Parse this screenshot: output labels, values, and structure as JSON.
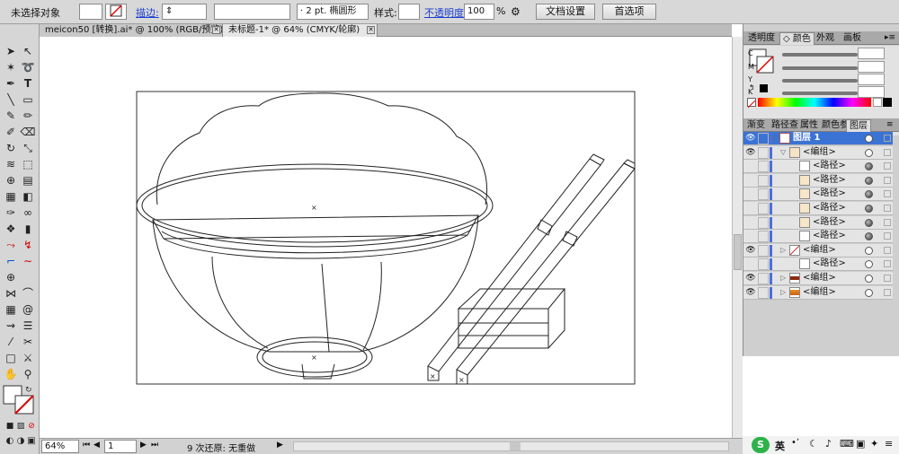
{
  "control_bar": {
    "selection": "未选择对象",
    "stroke_label": "描边:",
    "stroke_size": "2 pt.",
    "brush": "椭圆形",
    "style_label": "样式:",
    "opacity_label": "不透明度:",
    "opacity_value": "100",
    "opacity_unit": "%",
    "doc_setup": "文档设置",
    "prefs": "首选项"
  },
  "tabs": [
    {
      "label": "meicon50 [转换].ai* @ 100% (RGB/预览)"
    },
    {
      "label": "未标题-1* @ 64% (CMYK/轮廓)"
    }
  ],
  "status": {
    "zoom": "64%",
    "page": "1",
    "history": "9 次还原: 无重做"
  },
  "color_panel": {
    "tabs": [
      "透明度",
      "颜色",
      "外观",
      "画板"
    ],
    "channels": [
      "C",
      "M",
      "Y",
      "K"
    ]
  },
  "layers_panel": {
    "tabs": [
      "渐变",
      "路径查",
      "属性",
      "颜色参",
      "图层"
    ],
    "rows": [
      {
        "label": "图层 1",
        "indent": 0,
        "visible": true,
        "twisty": "open",
        "thumb": "layer",
        "target": "hollow",
        "selected": true
      },
      {
        "label": "<编组>",
        "indent": 1,
        "visible": true,
        "twisty": "open",
        "thumb": "group",
        "target": "hollow",
        "selected": false
      },
      {
        "label": "<路径>",
        "indent": 2,
        "visible": false,
        "twisty": "",
        "thumb": "blank",
        "target": "filled",
        "selected": false
      },
      {
        "label": "<路径>",
        "indent": 2,
        "visible": false,
        "twisty": "",
        "thumb": "beige",
        "target": "filled",
        "selected": false
      },
      {
        "label": "<路径>",
        "indent": 2,
        "visible": false,
        "twisty": "",
        "thumb": "beige",
        "target": "filled",
        "selected": false
      },
      {
        "label": "<路径>",
        "indent": 2,
        "visible": false,
        "twisty": "",
        "thumb": "beige",
        "target": "filled",
        "selected": false
      },
      {
        "label": "<路径>",
        "indent": 2,
        "visible": false,
        "twisty": "",
        "thumb": "beige",
        "target": "filled",
        "selected": false
      },
      {
        "label": "<路径>",
        "indent": 2,
        "visible": false,
        "twisty": "",
        "thumb": "blank",
        "target": "filled",
        "selected": false
      },
      {
        "label": "<编组>",
        "indent": 1,
        "visible": true,
        "twisty": "closed",
        "thumb": "slash",
        "target": "hollow",
        "selected": false
      },
      {
        "label": "<路径>",
        "indent": 2,
        "visible": false,
        "twisty": "",
        "thumb": "blank",
        "target": "hollow",
        "selected": false
      },
      {
        "label": "<编组>",
        "indent": 1,
        "visible": true,
        "twisty": "closed",
        "thumb": "brown",
        "target": "hollow",
        "selected": false
      },
      {
        "label": "<编组>",
        "indent": 1,
        "visible": true,
        "twisty": "closed",
        "thumb": "orange",
        "target": "hollow",
        "selected": false
      }
    ]
  },
  "taskbar": {
    "ime": "英"
  }
}
